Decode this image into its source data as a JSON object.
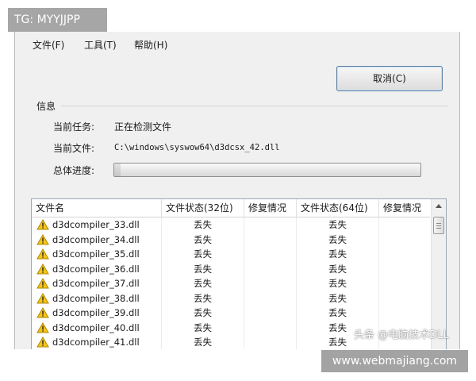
{
  "watermark": {
    "top_left": "TG: MYYJJPP",
    "site": "www.webmajiang.com",
    "tech": "头条 @电脑技术DLL"
  },
  "menu": [
    {
      "label": "文件(F)"
    },
    {
      "label": "工具(T)"
    },
    {
      "label": "帮助(H)"
    }
  ],
  "cancel_button": "取消(C)",
  "info": {
    "title": "信息",
    "current_task_label": "当前任务:",
    "current_task_value": "正在检测文件",
    "current_file_label": "当前文件:",
    "current_file_value": "C:\\windows\\syswow64\\d3dcsx_42.dll",
    "progress_label": "总体进度:",
    "progress_fraction": 0.02
  },
  "table": {
    "columns": [
      "文件名",
      "文件状态(32位)",
      "修复情况",
      "文件状态(64位)",
      "修复情况"
    ],
    "rows": [
      {
        "name": "d3dcompiler_33.dll",
        "s32": "丢失",
        "r32": "",
        "s64": "丢失",
        "r64": ""
      },
      {
        "name": "d3dcompiler_34.dll",
        "s32": "丢失",
        "r32": "",
        "s64": "丢失",
        "r64": ""
      },
      {
        "name": "d3dcompiler_35.dll",
        "s32": "丢失",
        "r32": "",
        "s64": "丢失",
        "r64": ""
      },
      {
        "name": "d3dcompiler_36.dll",
        "s32": "丢失",
        "r32": "",
        "s64": "丢失",
        "r64": ""
      },
      {
        "name": "d3dcompiler_37.dll",
        "s32": "丢失",
        "r32": "",
        "s64": "丢失",
        "r64": ""
      },
      {
        "name": "d3dcompiler_38.dll",
        "s32": "丢失",
        "r32": "",
        "s64": "丢失",
        "r64": ""
      },
      {
        "name": "d3dcompiler_39.dll",
        "s32": "丢失",
        "r32": "",
        "s64": "丢失",
        "r64": ""
      },
      {
        "name": "d3dcompiler_40.dll",
        "s32": "丢失",
        "r32": "",
        "s64": "丢失",
        "r64": ""
      },
      {
        "name": "d3dcompiler_41.dll",
        "s32": "丢失",
        "r32": "",
        "s64": "丢失",
        "r64": ""
      }
    ]
  },
  "icons": {
    "row_icon": "warning-triangle-icon",
    "scroll_up": "scroll-up-arrow-icon"
  },
  "colors": {
    "warning_fill": "#f5c518",
    "warning_stroke": "#b08a00",
    "selection_border": "#5a7fa6"
  }
}
